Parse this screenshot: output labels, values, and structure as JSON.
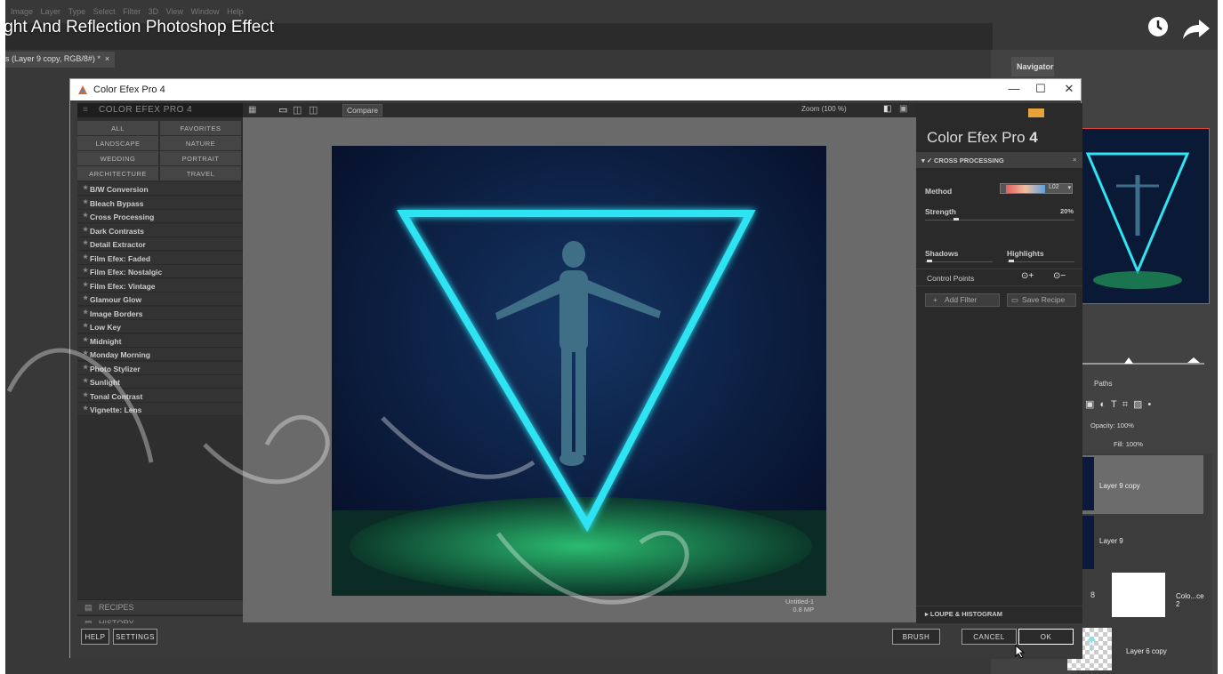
{
  "video_title": "ight And Reflection Photoshop Effect",
  "ps": {
    "menu": [
      "Image",
      "Layer",
      "Type",
      "Select",
      "Filter",
      "3D",
      "View",
      "Window",
      "Help"
    ],
    "doc_tab": "s (Layer 9 copy, RGB/8#) *",
    "doc_close": "×",
    "nav_tab": "Navigator",
    "paths_tab": "Paths",
    "opacity_label": "Opacity:",
    "opacity_value": "100%",
    "fill_label": "Fill:",
    "fill_value": "100%",
    "layers": [
      "Layer 9 copy",
      "Layer 9",
      "Colo...ce 2",
      "Layer 6 copy"
    ]
  },
  "dialog": {
    "title": "Color Efex Pro 4",
    "min": "—",
    "max": "☐",
    "close": "✕",
    "sidebar_heading": "COLOR EFEX PRO 4",
    "categories": [
      "ALL",
      "FAVORITES",
      "LANDSCAPE",
      "NATURE",
      "WEDDING",
      "PORTRAIT",
      "ARCHITECTURE",
      "TRAVEL"
    ],
    "filters": [
      "B/W Conversion",
      "Bleach Bypass",
      "Cross Processing",
      "Dark Contrasts",
      "Detail Extractor",
      "Film Efex: Faded",
      "Film Efex: Nostalgic",
      "Film Efex: Vintage",
      "Glamour Glow",
      "Image Borders",
      "Low Key",
      "Midnight",
      "Monday Morning",
      "Photo Stylizer",
      "Sunlight",
      "Tonal Contrast",
      "Vignette: Lens"
    ],
    "recipes": "RECIPES",
    "history": "HISTORY",
    "compare": "Compare",
    "zoom": "Zoom (100 %)",
    "canvas_name": "Untitled-1",
    "canvas_size": "0.8 MP",
    "panel_title_a": "Color Efex Pro",
    "panel_title_b": "4",
    "section": "CROSS PROCESSING",
    "method_label": "Method",
    "method_value": "L02",
    "strength_label": "Strength",
    "strength_value": "20%",
    "shadows_label": "Shadows",
    "highlights_label": "Highlights",
    "control_points": "Control Points",
    "add_filter": "Add Filter",
    "save_recipe": "Save Recipe",
    "loupe": "LOUPE & HISTOGRAM",
    "buttons": {
      "help": "HELP",
      "settings": "SETTINGS",
      "brush": "BRUSH",
      "cancel": "CANCEL",
      "ok": "OK"
    }
  },
  "colors": {
    "neon": "#2fe3f2",
    "grass": "#1f9b5a",
    "sky": "#0b1a3c"
  }
}
